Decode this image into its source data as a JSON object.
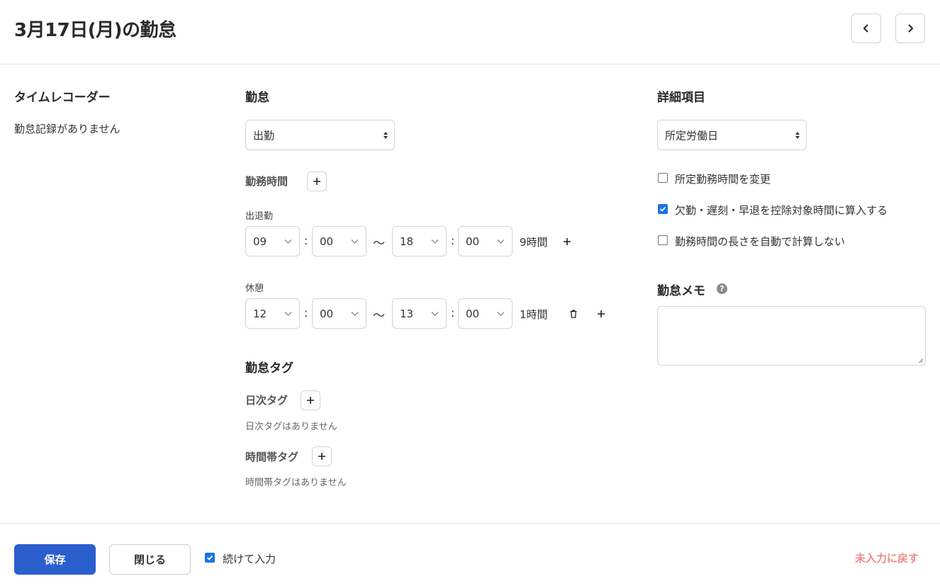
{
  "header": {
    "title": "3月17日(月)の勤怠"
  },
  "time_recorder": {
    "title": "タイムレコーダー",
    "empty": "勤怠記録がありません"
  },
  "attendance": {
    "title": "勤怠",
    "type_selected": "出勤",
    "work_time_label": "勤務時間",
    "clock_in_out_label": "出退勤",
    "clock": {
      "start_hour": "09",
      "start_minute": "00",
      "separator": "〜",
      "end_hour": "18",
      "end_minute": "00",
      "duration": "9時間"
    },
    "break_label": "休憩",
    "break": {
      "start_hour": "12",
      "start_minute": "00",
      "separator": "〜",
      "end_hour": "13",
      "end_minute": "00",
      "duration": "1時間"
    }
  },
  "tags": {
    "title": "勤怠タグ",
    "daily_label": "日次タグ",
    "daily_empty": "日次タグはありません",
    "timeband_label": "時間帯タグ",
    "timeband_empty": "時間帯タグはありません"
  },
  "details": {
    "title": "詳細項目",
    "day_type_selected": "所定労働日",
    "options": [
      {
        "label": "所定勤務時間を変更",
        "checked": false
      },
      {
        "label": "欠勤・遅刻・早退を控除対象時間に算入する",
        "checked": true
      },
      {
        "label": "勤務時間の長さを自動で計算しない",
        "checked": false
      }
    ],
    "memo_label": "勤怠メモ",
    "memo_value": ""
  },
  "footer": {
    "save_label": "保存",
    "close_label": "閉じる",
    "continue_label": "続けて入力",
    "continue_checked": true,
    "reset_label": "未入力に戻す"
  },
  "colors": {
    "primary": "#2b5fce",
    "checkbox_checked": "#1a73e8",
    "reset_link": "#ef8a8a"
  },
  "icons": [
    "chevron-left-icon",
    "chevron-right-icon",
    "plus-icon",
    "trash-icon",
    "help-icon",
    "sort-arrows-icon",
    "chevron-down-icon"
  ]
}
